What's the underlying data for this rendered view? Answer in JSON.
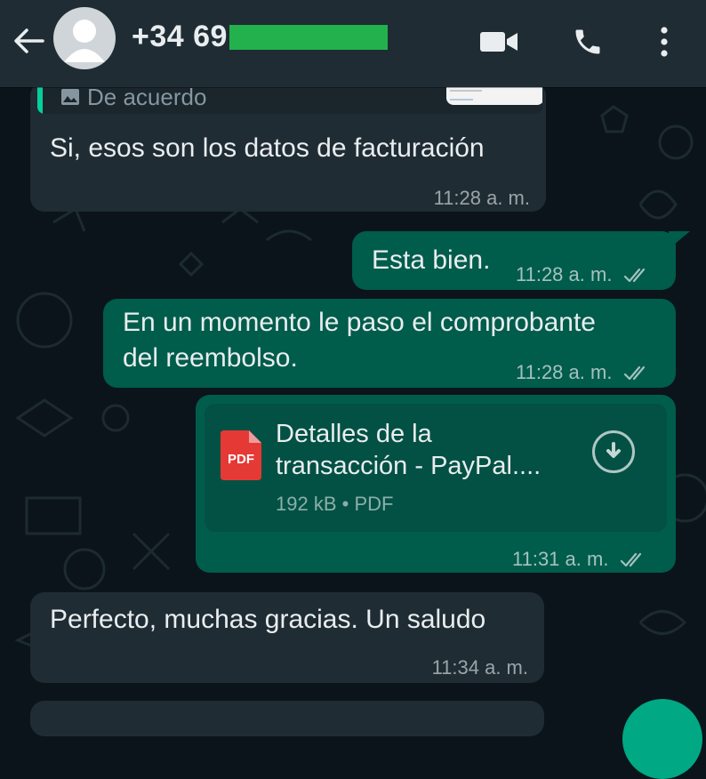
{
  "header": {
    "contact_name": "+34 69"
  },
  "messages": [
    {
      "type": "in",
      "quoted_text": "De acuerdo",
      "text": "Si, esos son los datos de facturación",
      "time": "11:28 a. m."
    },
    {
      "type": "out",
      "text": "Esta bien.",
      "time": "11:28 a. m."
    },
    {
      "type": "out",
      "text_line1": "En un momento le paso el comprobante",
      "text_line2": "del reembolso.",
      "time": "11:28 a. m."
    },
    {
      "type": "out",
      "doc_name_line1": "Detalles de la",
      "doc_name_line2": "transacción - PayPal....",
      "doc_icon_label": "PDF",
      "doc_size": "192 kB",
      "doc_format": "PDF",
      "time": "11:31 a. m."
    },
    {
      "type": "in",
      "text": "Perfecto, muchas gracias. Un saludo",
      "time": "11:34 a. m."
    }
  ],
  "colors": {
    "header_bg": "#1f2c34",
    "chat_bg": "#0b141a",
    "incoming_bubble": "#1f2c34",
    "outgoing_bubble": "#005c4b",
    "accent": "#00a884",
    "redaction": "#22b14c"
  },
  "icons": [
    "back-arrow-icon",
    "avatar-icon",
    "video-call-icon",
    "phone-icon",
    "more-options-icon",
    "image-icon",
    "pdf-icon",
    "download-icon",
    "double-check-icon"
  ]
}
